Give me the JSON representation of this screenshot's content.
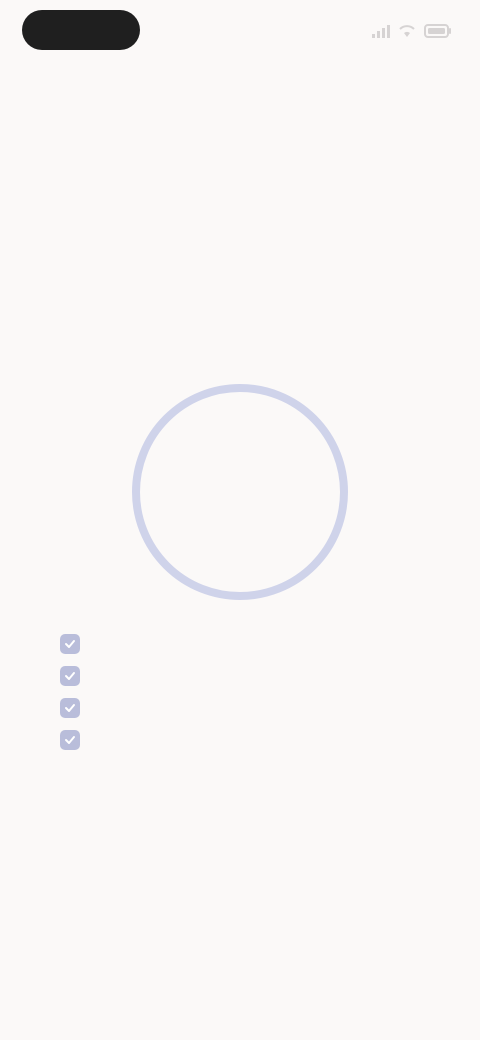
{
  "status_bar": {
    "time": "",
    "icons": [
      "signal-icon",
      "wifi-icon",
      "battery-icon"
    ]
  },
  "hint": "",
  "title": "",
  "ring": {
    "value": "",
    "color": "#cfd3ea"
  },
  "checklist": {
    "items": [
      {
        "label": "",
        "checked": true
      },
      {
        "label": "",
        "checked": true
      },
      {
        "label": "",
        "checked": true
      },
      {
        "label": "",
        "checked": true
      }
    ]
  },
  "colors": {
    "accent": "#b9bdda",
    "background": "#fbf9f8"
  }
}
